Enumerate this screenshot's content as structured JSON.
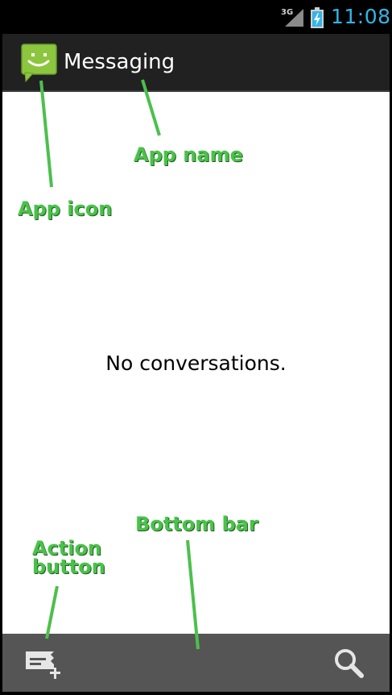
{
  "status_bar": {
    "network_type": "3G",
    "time": "11:08"
  },
  "action_bar": {
    "app_name": "Messaging",
    "app_icon": "smiley-speech-bubble-icon"
  },
  "content": {
    "empty_message": "No conversations."
  },
  "bottom_bar": {
    "compose_icon": "new-message-icon",
    "search_icon": "search-icon"
  },
  "annotations": {
    "app_name": "App name",
    "app_icon": "App icon",
    "bottom_bar": "Bottom bar",
    "action_button_line1": "Action",
    "action_button_line2": "button"
  },
  "colors": {
    "status_time": "#33b5e5",
    "action_bar_bg": "#212121",
    "bottom_bar_bg": "#555555",
    "app_icon_green": "#8cc63f",
    "annotation_green": "#4cc04c"
  }
}
